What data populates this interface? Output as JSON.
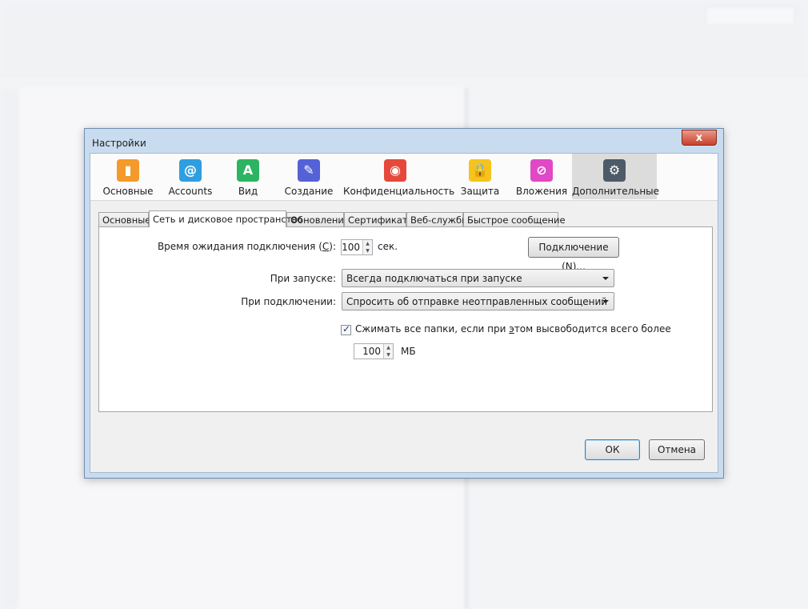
{
  "dialog": {
    "title": "Настройки",
    "close_label": "x"
  },
  "panes": [
    {
      "label": "Основные",
      "icon": "phone-icon",
      "color": "#f39a2b",
      "glyph": "▮"
    },
    {
      "label": "Accounts",
      "icon": "at-icon",
      "color": "#2f9ee0",
      "glyph": "@"
    },
    {
      "label": "Вид",
      "icon": "font-a-icon",
      "color": "#2db463",
      "glyph": "A"
    },
    {
      "label": "Создание",
      "icon": "pencil-icon",
      "color": "#5561d6",
      "glyph": "✎"
    },
    {
      "label": "Конфиденциальность",
      "icon": "privacy-mask-icon",
      "color": "#e5493b",
      "glyph": "◉"
    },
    {
      "label": "Защита",
      "icon": "lock-icon",
      "color": "#f5c31b",
      "glyph": "🔒"
    },
    {
      "label": "Вложения",
      "icon": "paperclip-icon",
      "color": "#e048c5",
      "glyph": "⊘"
    },
    {
      "label": "Дополнительные",
      "icon": "gear-icon",
      "color": "#4d5a68",
      "glyph": "⚙"
    }
  ],
  "tabs": [
    {
      "label": "Основные"
    },
    {
      "label": "Сеть и дисковое пространство"
    },
    {
      "label": "Обновления"
    },
    {
      "label": "Сертификаты"
    },
    {
      "label": "Веб-службы"
    },
    {
      "label": "Быстрое сообщение"
    }
  ],
  "network": {
    "timeout_label_pre": "Время ожидания подключения (",
    "timeout_label_key": "С",
    "timeout_label_post": "):",
    "timeout_value": "100",
    "timeout_unit": "сек.",
    "connection_button_pre": "Подключение (",
    "connection_button_key": "N",
    "connection_button_post": ")...",
    "startup_label": "При запуске:",
    "startup_value": "Всегда подключаться при запуске",
    "connect_label": "При подключении:",
    "connect_value": "Спросить об отправке неотправленных сообщений",
    "compact_checked": true,
    "compact_label_pre": "Сжимать все папки, если при ",
    "compact_label_key": "э",
    "compact_label_post": "том высвободится всего более",
    "compact_value": "100",
    "compact_unit": "МБ"
  },
  "buttons": {
    "ok": "ОК",
    "cancel": "Отмена"
  }
}
